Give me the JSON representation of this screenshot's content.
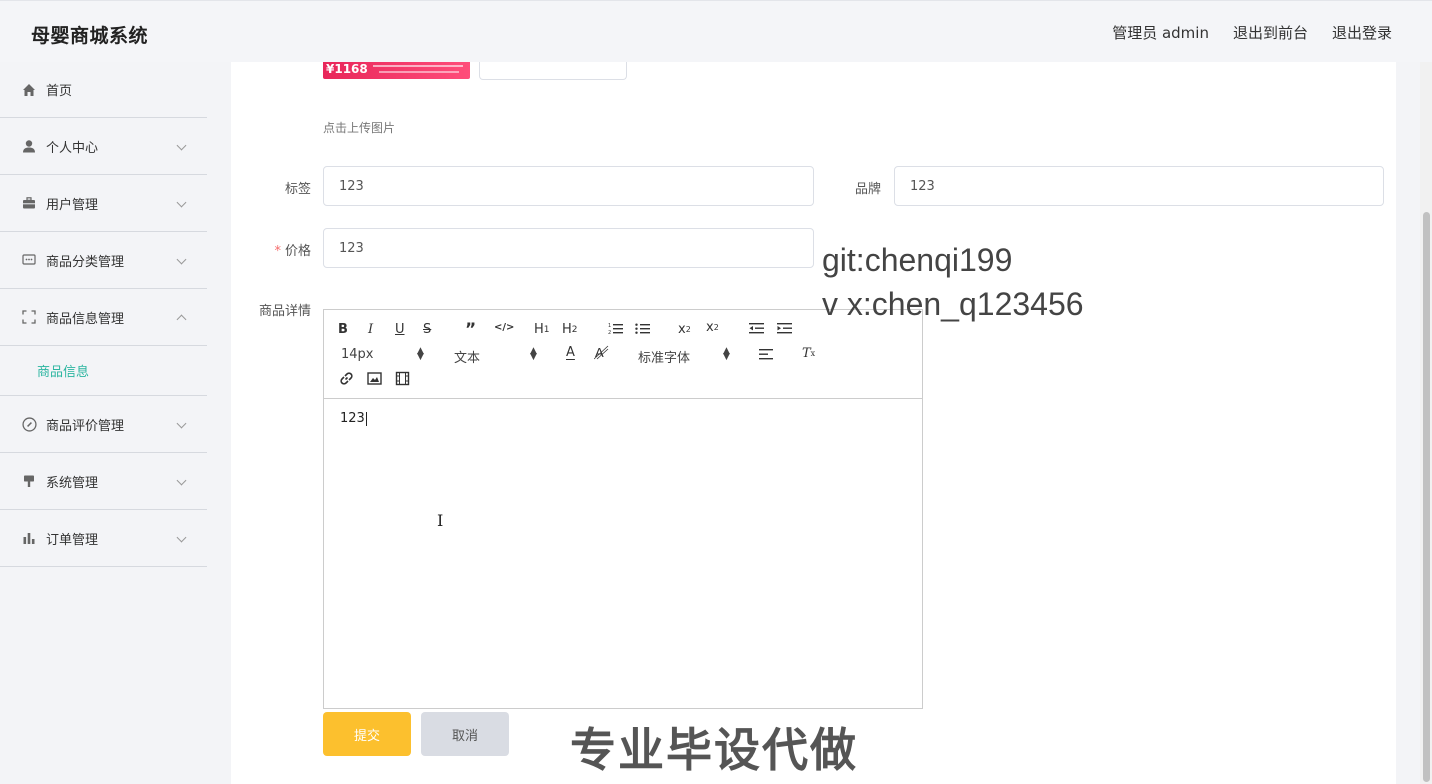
{
  "header": {
    "title": "母婴商城系统",
    "user": "管理员 admin",
    "to_front": "退出到前台",
    "logout": "退出登录"
  },
  "sidebar": {
    "items": [
      {
        "label": "首页",
        "icon": "home-icon",
        "chevron": false
      },
      {
        "label": "个人中心",
        "icon": "user-icon",
        "chevron": "down"
      },
      {
        "label": "用户管理",
        "icon": "briefcase-icon",
        "chevron": "down"
      },
      {
        "label": "商品分类管理",
        "icon": "chat-icon",
        "chevron": "down"
      },
      {
        "label": "商品信息管理",
        "icon": "fullscreen-icon",
        "chevron": "up"
      },
      {
        "label": "商品评价管理",
        "icon": "compass-icon",
        "chevron": "down"
      },
      {
        "label": "系统管理",
        "icon": "brush-icon",
        "chevron": "down"
      },
      {
        "label": "订单管理",
        "icon": "bar-chart-icon",
        "chevron": "down"
      }
    ],
    "active_sub": "商品信息",
    "active_color": "#2bb5a0"
  },
  "form": {
    "promo_price": "¥1168",
    "upload_hint": "点击上传图片",
    "tag_label": "标签",
    "tag_value": "123",
    "brand_label": "品牌",
    "brand_value": "123",
    "price_required": "*",
    "price_label": "价格",
    "price_value": "123",
    "detail_label": "商品详情",
    "submit": "提交",
    "cancel": "取消",
    "submit_color": "#fcc02e"
  },
  "editor": {
    "font_size": "14px",
    "block_type": "文本",
    "font_family": "标准字体",
    "content": "123"
  },
  "watermark": {
    "line1": "git:chenqi199",
    "line2": "v x:chen_q123456",
    "line3": "专业毕设代做"
  }
}
